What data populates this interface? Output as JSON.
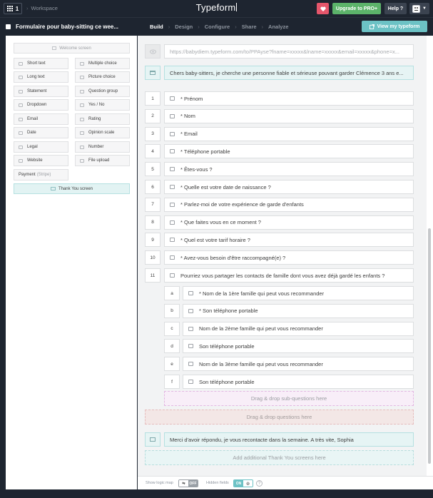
{
  "topbar": {
    "workspace_count": "1",
    "workspace_label": "Workspace",
    "brand": "Typeform",
    "upgrade_label": "Upgrade to PRO+",
    "help_label": "Help ?"
  },
  "form": {
    "title": "Formulaire pour baby-sitting ce wee...",
    "nav": [
      "Build",
      "Design",
      "Configure",
      "Share",
      "Analyze"
    ],
    "active_nav": "Build",
    "view_label": "View my typeform"
  },
  "sidebar": {
    "welcome_label": "Welcome screen",
    "fields_left": [
      "Short text",
      "Long text",
      "Statement",
      "Dropdown",
      "Email",
      "Date",
      "Legal",
      "Website",
      "Payment"
    ],
    "payment_sub": "(Stripe)",
    "fields_right": [
      "Multiple choice",
      "Picture choice",
      "Question group",
      "Yes / No",
      "Rating",
      "Opinion scale",
      "Number",
      "File upload"
    ],
    "thankyou_label": "Thank You screen"
  },
  "builder": {
    "url": "https://babydiem.typeform.com/to/PPAyse?fname=xxxxx&lname=xxxxx&email=xxxxx&phone=x...",
    "welcome_text": "Chers baby-sitters, je cherche une personne fiable et sérieuse pouvant garder Clémence 3 ans e...",
    "questions": [
      {
        "num": "1",
        "text": "* Prénom",
        "icon": "short-text-icon"
      },
      {
        "num": "2",
        "text": "* Nom",
        "icon": "short-text-icon"
      },
      {
        "num": "3",
        "text": "* Email",
        "icon": "email-icon"
      },
      {
        "num": "4",
        "text": "* Téléphone portable",
        "icon": "number-icon"
      },
      {
        "num": "5",
        "text": "* Êtes-vous ?",
        "icon": "multiple-choice-icon"
      },
      {
        "num": "6",
        "text": "* Quelle est votre date de naissance ?",
        "icon": "date-icon"
      },
      {
        "num": "7",
        "text": "* Parlez-moi de votre expérience de garde d'enfants",
        "icon": "long-text-icon"
      },
      {
        "num": "8",
        "text": "* Que faites vous en ce moment ?",
        "icon": "short-text-icon"
      },
      {
        "num": "9",
        "text": "* Quel est votre tarif horaire ?",
        "icon": "number-icon"
      },
      {
        "num": "10",
        "text": "* Avez-vous besoin d'être raccompagné(e) ?",
        "icon": "yes-no-icon"
      },
      {
        "num": "11",
        "text": "Pourriez vous partager les contacts de famille dont vous avez déjà gardé les enfants ?",
        "icon": "question-group-icon"
      }
    ],
    "subquestions": [
      {
        "letter": "a",
        "text": "* Nom de la 1ère famille qui peut vous recommander",
        "icon": "short-text-icon"
      },
      {
        "letter": "b",
        "text": "* Son téléphone portable",
        "icon": "number-icon"
      },
      {
        "letter": "c",
        "text": "Nom de la 2ème famille qui peut vous recommander",
        "icon": "short-text-icon"
      },
      {
        "letter": "d",
        "text": "Son téléphone portable",
        "icon": "number-icon"
      },
      {
        "letter": "e",
        "text": "Nom de la 3ème famille qui peut vous recommander",
        "icon": "short-text-icon"
      },
      {
        "letter": "f",
        "text": "Son téléphone portable",
        "icon": "number-icon"
      }
    ],
    "drop_sub": "Drag & drop sub-questions here",
    "drop_questions": "Drag & drop questions here",
    "thankyou_text": "Merci d'avoir répondu, je vous recontacte dans la semaine. A très vite, Sophia",
    "add_thankyou": "Add additional Thank You screens here"
  },
  "bottombar": {
    "logic_label": "Show logic map",
    "logic_toggle": "OFF",
    "hidden_label": "Hidden fields",
    "hidden_toggle": "ON",
    "info_label": "?"
  },
  "colors": {
    "dark_bg": "#1e2530",
    "upgrade": "#5cb36a",
    "heart": "#e5566b",
    "teal": "#6cc2c5",
    "panel_bg": "#f2f3f4"
  }
}
